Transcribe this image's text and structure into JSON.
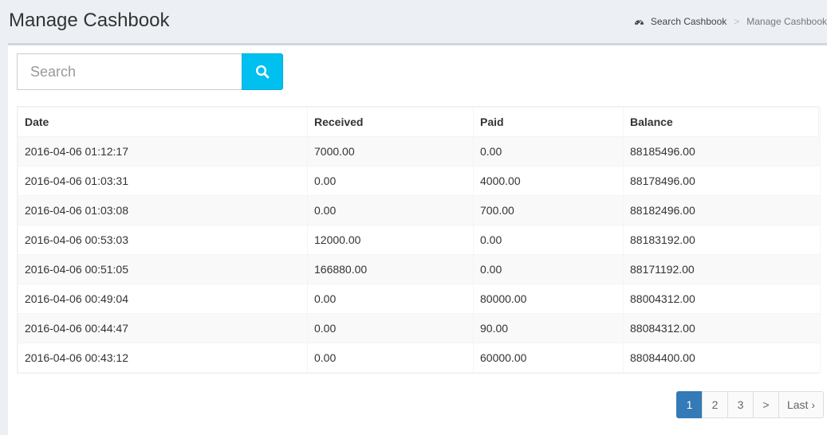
{
  "header": {
    "title": "Manage Cashbook",
    "breadcrumb": {
      "icon": "dashboard-icon",
      "link_label": "Search Cashbook",
      "separator": ">",
      "current": "Manage Cashbook"
    }
  },
  "search": {
    "placeholder": "Search",
    "value": "",
    "button_icon": "search-icon"
  },
  "table": {
    "headers": [
      "Date",
      "Received",
      "Paid",
      "Balance"
    ],
    "rows": [
      [
        "2016-04-06 01:12:17",
        "7000.00",
        "0.00",
        "88185496.00"
      ],
      [
        "2016-04-06 01:03:31",
        "0.00",
        "4000.00",
        "88178496.00"
      ],
      [
        "2016-04-06 01:03:08",
        "0.00",
        "700.00",
        "88182496.00"
      ],
      [
        "2016-04-06 00:53:03",
        "12000.00",
        "0.00",
        "88183192.00"
      ],
      [
        "2016-04-06 00:51:05",
        "166880.00",
        "0.00",
        "88171192.00"
      ],
      [
        "2016-04-06 00:49:04",
        "0.00",
        "80000.00",
        "88004312.00"
      ],
      [
        "2016-04-06 00:44:47",
        "0.00",
        "90.00",
        "88084312.00"
      ],
      [
        "2016-04-06 00:43:12",
        "0.00",
        "60000.00",
        "88084400.00"
      ]
    ]
  },
  "pagination": {
    "pages": [
      "1",
      "2",
      "3"
    ],
    "active_page": "1",
    "next_label": ">",
    "last_label": "Last ›"
  },
  "colors": {
    "accent_search": "#00c0ef",
    "active_page": "#337ab7",
    "background": "#ecf0f5"
  }
}
